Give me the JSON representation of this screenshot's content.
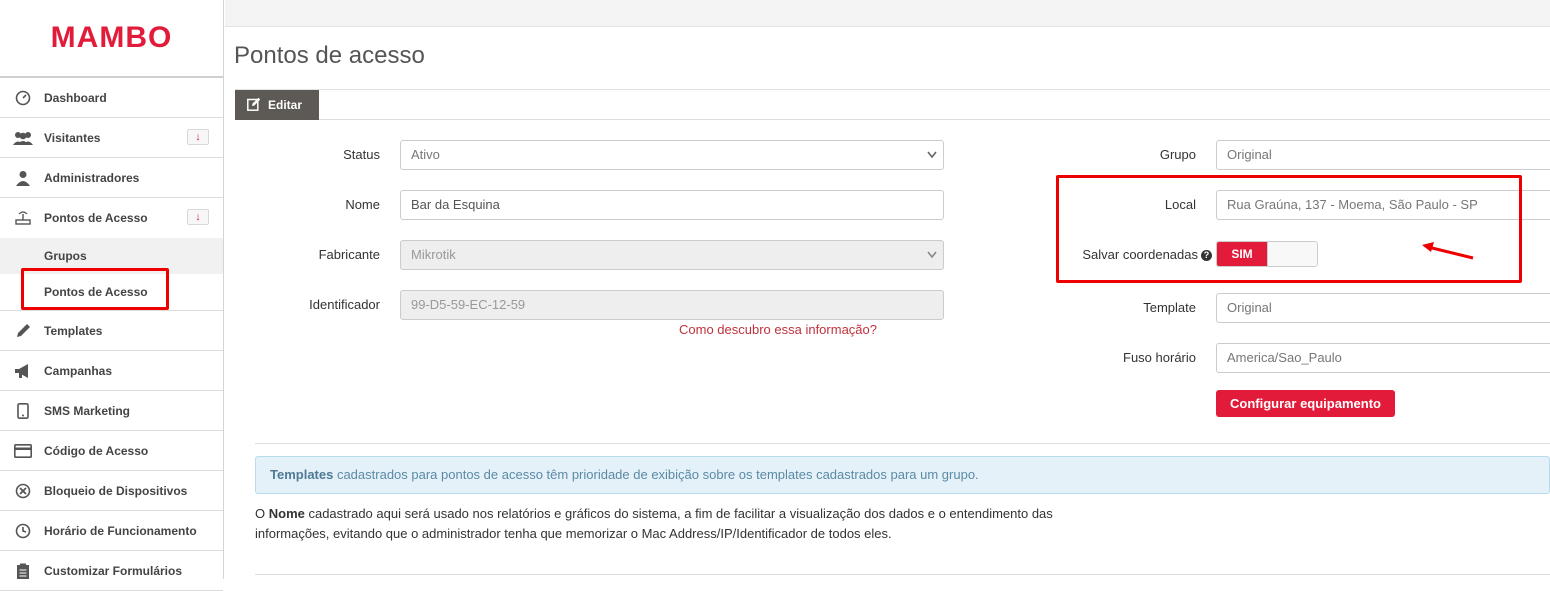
{
  "brand": {
    "logo_text": "MAMBO",
    "accent": "#e31b3a"
  },
  "sidebar": {
    "items": [
      {
        "label": "Dashboard",
        "icon": "dashboard-icon"
      },
      {
        "label": "Visitantes",
        "icon": "users-icon",
        "expand": "↓"
      },
      {
        "label": "Administradores",
        "icon": "user-icon"
      },
      {
        "label": "Pontos de Acesso",
        "icon": "router-icon",
        "expand": "↓"
      },
      {
        "label": "Templates",
        "icon": "pencil-icon"
      },
      {
        "label": "Campanhas",
        "icon": "megaphone-icon"
      },
      {
        "label": "SMS Marketing",
        "icon": "phone-icon"
      },
      {
        "label": "Código de Acesso",
        "icon": "card-icon"
      },
      {
        "label": "Bloqueio de Dispositivos",
        "icon": "block-icon"
      },
      {
        "label": "Horário de Funcionamento",
        "icon": "clock-icon"
      },
      {
        "label": "Customizar Formulários",
        "icon": "clipboard-icon"
      }
    ],
    "sub_items": [
      {
        "label": "Grupos"
      },
      {
        "label": "Pontos de Acesso"
      }
    ]
  },
  "page": {
    "title": "Pontos de acesso"
  },
  "tab": {
    "edit_label": "Editar"
  },
  "form": {
    "status": {
      "label": "Status",
      "value": "Ativo"
    },
    "nome": {
      "label": "Nome",
      "value": "Bar da Esquina"
    },
    "fabricante": {
      "label": "Fabricante",
      "value": "Mikrotik"
    },
    "identificador": {
      "label": "Identificador",
      "value": "99-D5-59-EC-12-59"
    },
    "help_link": "Como descubro essa informação?",
    "grupo": {
      "label": "Grupo",
      "value": "Original"
    },
    "local": {
      "label": "Local",
      "value": "Rua Graúna, 137 - Moema, São Paulo - SP"
    },
    "salvar": {
      "label": "Salvar coordenadas",
      "help": "?",
      "toggle_on": "SIM"
    },
    "template": {
      "label": "Template",
      "value": "Original"
    },
    "fuso": {
      "label": "Fuso horário",
      "value": "America/Sao_Paulo"
    },
    "config_button": "Configurar equipamento"
  },
  "info": {
    "bold": "Templates",
    "text": " cadastrados para pontos de acesso têm prioridade de exibição sobre os templates cadastrados para um grupo."
  },
  "note": {
    "prefix": "O ",
    "bold": "Nome",
    "text": " cadastrado aqui será usado nos relatórios e gráficos do sistema, a fim de facilitar a visualização dos dados e o entendimento das informações, evitando que o administrador tenha que memorizar o Mac Address/IP/Identificador de todos eles."
  }
}
